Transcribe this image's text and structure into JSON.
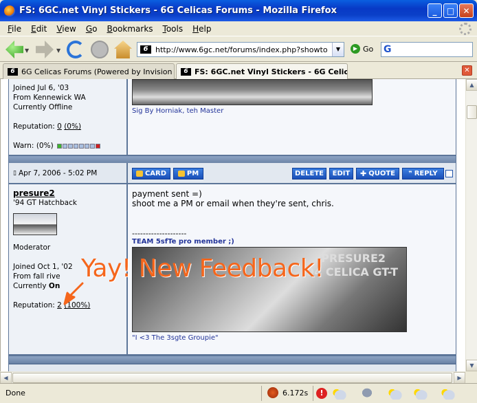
{
  "window": {
    "title": "FS: 6GC.net Vinyl Stickers - 6G Celicas Forums - Mozilla Firefox",
    "minimize": "_",
    "maximize": "□",
    "close": "✕"
  },
  "menu": [
    {
      "accel": "F",
      "rest": "ile"
    },
    {
      "accel": "E",
      "rest": "dit"
    },
    {
      "accel": "V",
      "rest": "iew"
    },
    {
      "accel": "G",
      "rest": "o"
    },
    {
      "accel": "B",
      "rest": "ookmarks"
    },
    {
      "accel": "T",
      "rest": "ools"
    },
    {
      "accel": "H",
      "rest": "elp"
    }
  ],
  "nav": {
    "site_icon": "6",
    "url": "http://www.6gc.net/forums/index.php?showtopic",
    "go_label": "Go",
    "search_icon": "G"
  },
  "tabs": {
    "inactive": "6G Celicas Forums (Powered by Invision Po...",
    "active": "FS: 6GC.net Vinyl Stickers - 6G Celicas..."
  },
  "post1": {
    "joined": "Joined Jul 6, '03",
    "from": "From Kennewick WA",
    "status": "Currently Offline",
    "reputation_label": "Reputation:",
    "reputation_value": "0",
    "reputation_pct": "(0%)",
    "warn_label": "Warn:",
    "warn_pct": "(0%)",
    "sig_caption": "Sig By Horniak, teh Master"
  },
  "post2": {
    "date": "Apr 7, 2006 - 5:02 PM",
    "buttons": {
      "card": "CARD",
      "pm": "PM",
      "delete": "DELETE",
      "edit": "EDIT",
      "quote": "QUOTE",
      "reply": "REPLY"
    },
    "username": "presure2",
    "user_title": "'94 GT Hatchback",
    "role": "Moderator",
    "joined": "Joined Oct 1, '02",
    "from": "From fall rive",
    "status_prefix": "Currently",
    "status_value": "On",
    "reputation_label": "Reputation:",
    "reputation_value": "2",
    "reputation_pct": "(100%)",
    "body_line1": "payment sent =)",
    "body_line2": "shoot me a PM or email when they're sent, chris.",
    "sig_divider": "--------------------",
    "team_text": "TEAM 5sfTe pro member ;)",
    "sig_image_text1": "PRESURE2",
    "sig_image_text2": "94 CELICA GT-T",
    "sig_caption": "\"I <3 The 3sgte Groupie\""
  },
  "overlay_text": "Yay! New Feedback!",
  "status": {
    "text": "Done",
    "timing": "6.172s"
  },
  "colors": {
    "accent": "#f5661c",
    "forum_bar": "#6d85a8",
    "button": "#1a4fb8"
  }
}
